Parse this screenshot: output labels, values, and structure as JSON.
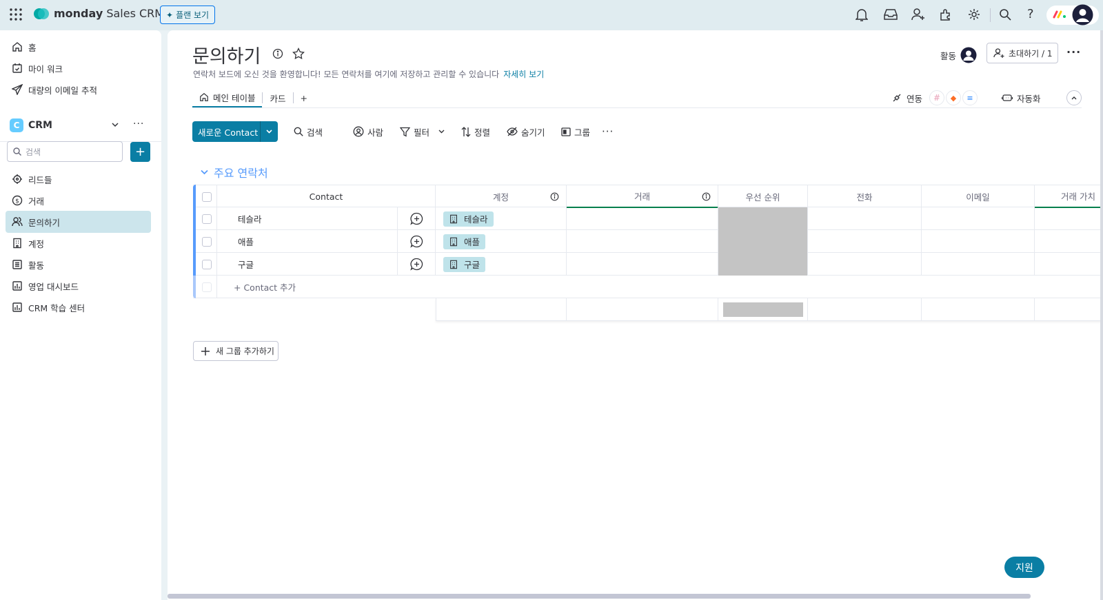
{
  "app": {
    "brand_bold": "monday",
    "brand_rest": " Sales CRM",
    "plan_button": "플랜 보기"
  },
  "sidebar": {
    "nav": [
      {
        "label": "홈",
        "icon": "home-icon"
      },
      {
        "label": "마이 워크",
        "icon": "calendar-check-icon"
      },
      {
        "label": "대량의 이메일 추적",
        "icon": "send-icon"
      }
    ],
    "workspace": {
      "badge": "C",
      "name": "CRM"
    },
    "search_placeholder": "검색",
    "boards": [
      {
        "label": "리드들",
        "icon": "target-icon"
      },
      {
        "label": "거래",
        "icon": "dollar-icon"
      },
      {
        "label": "문의하기",
        "icon": "contacts-icon",
        "active": true
      },
      {
        "label": "계정",
        "icon": "building-icon"
      },
      {
        "label": "활동",
        "icon": "list-icon"
      },
      {
        "label": "영업 대시보드",
        "icon": "dashboard-icon"
      },
      {
        "label": "CRM 학습 센터",
        "icon": "dashboard-icon"
      }
    ]
  },
  "board": {
    "title": "문의하기",
    "description": "연락처 보드에 오신 것을 환영합니다! 모든 연락처를 여기에 저장하고 관리할 수 있습니다",
    "more_link": "자세히 보기",
    "activity_label": "활동",
    "invite_label": "초대하기 / 1",
    "tabs": [
      "메인 테이블",
      "카드",
      "+"
    ],
    "integrations_label": "연동",
    "automations_label": "자동화"
  },
  "toolbar": {
    "new_item": "새로운 Contact",
    "search": "검색",
    "person": "사람",
    "filter": "필터",
    "sort": "정렬",
    "hide": "숨기기",
    "group": "그룹"
  },
  "group": {
    "title": "주요 연락처",
    "color": "#579bfc",
    "columns": [
      "Contact",
      "계정",
      "거래",
      "우선 순위",
      "전화",
      "이메일",
      "거래 가치"
    ],
    "rows": [
      {
        "name": "테슬라",
        "account": "테슬라"
      },
      {
        "name": "애플",
        "account": "애플"
      },
      {
        "name": "구글",
        "account": "구글"
      }
    ],
    "add_row": "+ Contact 추가"
  },
  "add_group": "새 그룹 추가하기",
  "help_button": "지원",
  "colors": {
    "primary": "#0a7ea4",
    "group_blue": "#579bfc",
    "priority_empty": "#c4c4c4",
    "chip": "#bfe3ea"
  }
}
